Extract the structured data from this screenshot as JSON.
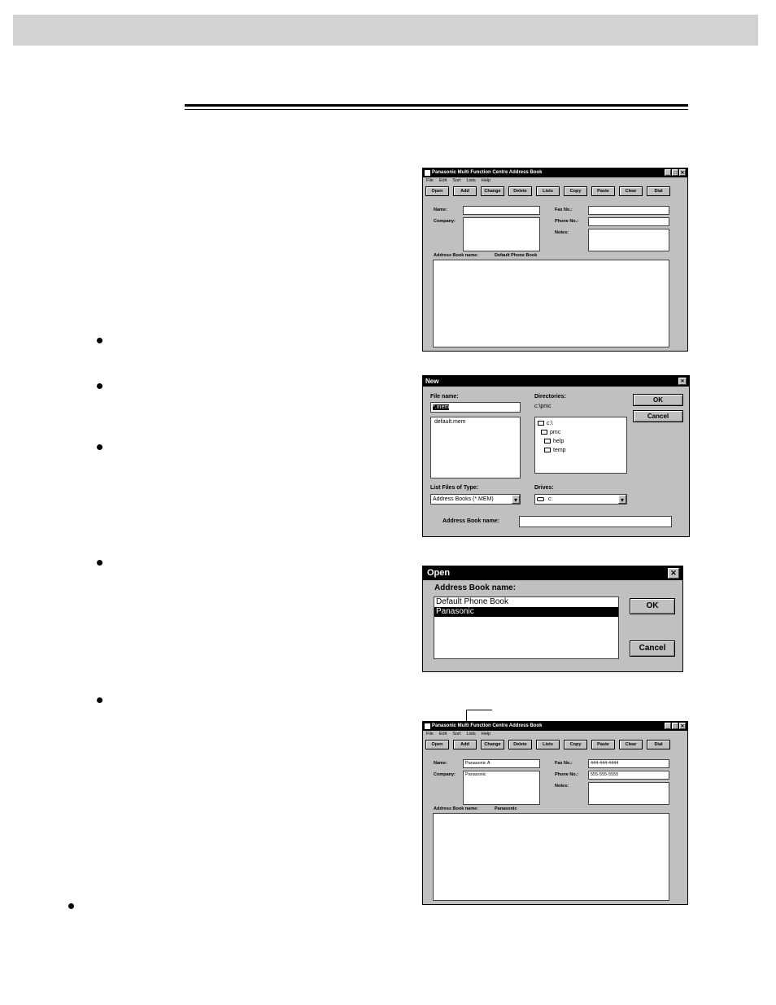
{
  "window": {
    "title": "Panasonic Multi Function Centre Address Book",
    "menu": [
      "File",
      "Edit",
      "Sort",
      "Lists",
      "Help"
    ],
    "toolbar": [
      "Open",
      "Add",
      "Change",
      "Delete",
      "Lists",
      "Copy",
      "Paste",
      "Clear",
      "Dial"
    ],
    "labels": {
      "name": "Name:",
      "company": "Company:",
      "fax": "Fax No.:",
      "phone": "Phone No.:",
      "notes": "Notes:",
      "book": "Address Book name:"
    },
    "book_name_1": "Default Phone Book",
    "book_name_2": "Panasonic",
    "entry": {
      "name": "Panasonic A",
      "company": "Panasonic",
      "fax": "444-444-4444",
      "phone": "555-555-5555"
    }
  },
  "new_dialog": {
    "title": "New",
    "file_name_label": "File name:",
    "file_name_value": "*.mem",
    "files": [
      "default.mem"
    ],
    "directories_label": "Directories:",
    "current_dir": "c:\\pmc",
    "dirs": [
      "c:\\",
      "pmc",
      "help",
      "temp"
    ],
    "list_type_label": "List Files of Type:",
    "list_type_value": "Address Books (*.MEM)",
    "drives_label": "Drives:",
    "drive_value": "c:",
    "book_label": "Address Book name:",
    "ok": "OK",
    "cancel": "Cancel"
  },
  "open_dialog": {
    "title": "Open",
    "label": "Address Book name:",
    "items": [
      "Default Phone Book",
      "Panasonic"
    ],
    "ok": "OK",
    "cancel": "Cancel"
  },
  "icons": {
    "close": "✕",
    "minimize": "_",
    "maximize": "□",
    "dropdown": "▾"
  }
}
